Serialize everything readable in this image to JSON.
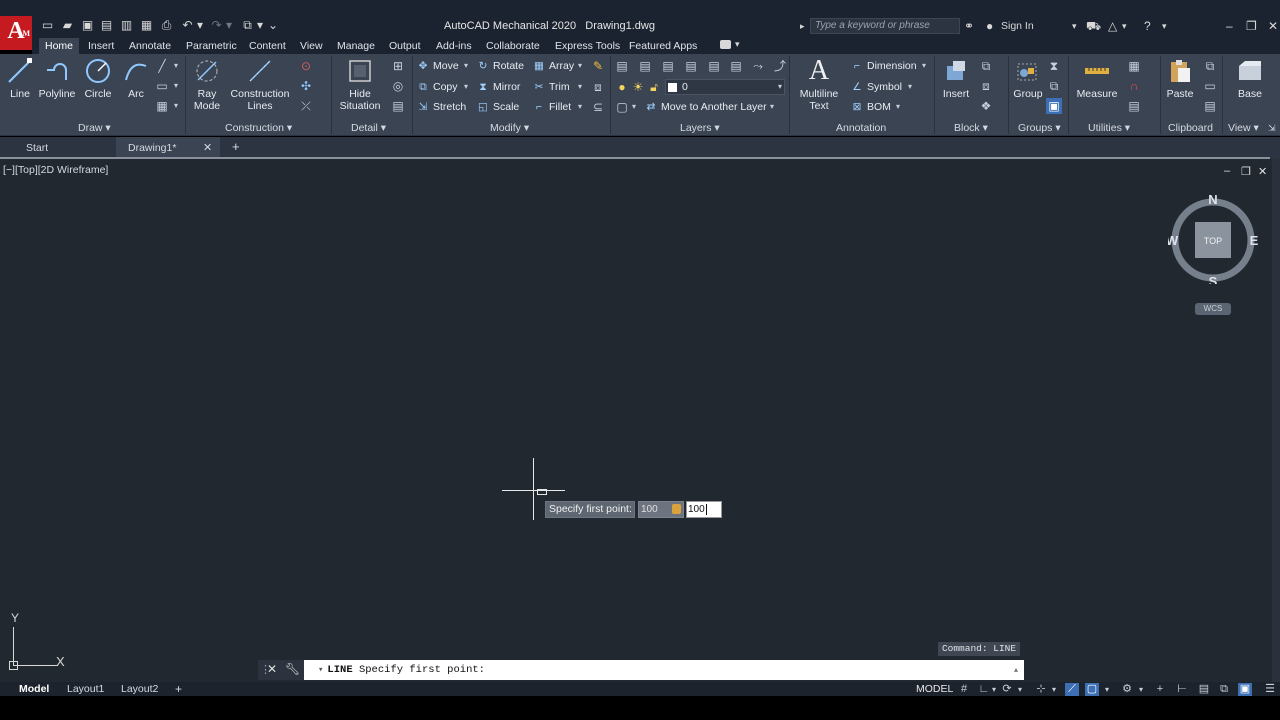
{
  "app": {
    "logo": "A",
    "logo_sub": "M",
    "title": "AutoCAD Mechanical 2020",
    "doc": "Drawing1.dwg",
    "search_placeholder": "Type a keyword or phrase",
    "sign_in": "Sign In"
  },
  "ribbon_tabs": [
    "Home",
    "Insert",
    "Annotate",
    "Parametric",
    "Content",
    "View",
    "Manage",
    "Output",
    "Add-ins",
    "Collaborate",
    "Express Tools",
    "Featured Apps"
  ],
  "draw": {
    "line": "Line",
    "polyline": "Polyline",
    "circle": "Circle",
    "arc": "Arc",
    "label": "Draw"
  },
  "construction": {
    "ray_mode_1": "Ray",
    "ray_mode_2": "Mode",
    "lines_1": "Construction",
    "lines_2": "Lines",
    "label": "Construction"
  },
  "detail": {
    "hide_1": "Hide",
    "hide_2": "Situation",
    "label": "Detail"
  },
  "modify": {
    "move": "Move",
    "rotate": "Rotate",
    "array": "Array",
    "copy": "Copy",
    "mirror": "Mirror",
    "trim": "Trim",
    "stretch": "Stretch",
    "scale": "Scale",
    "fillet": "Fillet",
    "label": "Modify"
  },
  "layers": {
    "current": "0",
    "move_to": "Move to Another Layer",
    "label": "Layers"
  },
  "annotation": {
    "mtext_1": "Multiline",
    "mtext_2": "Text",
    "dimension": "Dimension",
    "symbol": "Symbol",
    "bom": "BOM",
    "label": "Annotation"
  },
  "block": {
    "insert": "Insert",
    "label": "Block"
  },
  "groups": {
    "group": "Group",
    "label": "Groups"
  },
  "utilities": {
    "measure": "Measure",
    "label": "Utilities"
  },
  "clipboard": {
    "paste": "Paste",
    "label": "Clipboard"
  },
  "view": {
    "base": "Base",
    "label": "View"
  },
  "doc_tabs": {
    "start": "Start",
    "drawing": "Drawing1*"
  },
  "viewport": {
    "controls": "[−][Top][2D Wireframe]"
  },
  "viewcube": {
    "n": "N",
    "s": "S",
    "e": "E",
    "w": "W",
    "face": "TOP",
    "wcs": "WCS"
  },
  "dynamic_input": {
    "prompt": "Specify first point:",
    "x": "100",
    "y": "100"
  },
  "ucs": {
    "x": "X",
    "y": "Y"
  },
  "command": {
    "history": "Command: LINE",
    "keyword": "LINE",
    "text": "Specify first point:"
  },
  "layouts": {
    "model": "Model",
    "layout1": "Layout1",
    "layout2": "Layout2"
  },
  "status": {
    "model": "MODEL"
  },
  "colors": {
    "accent": "#3d6fb4",
    "canvas": "#212830",
    "ribbon": "#3b4453",
    "logo": "#c41a20"
  }
}
